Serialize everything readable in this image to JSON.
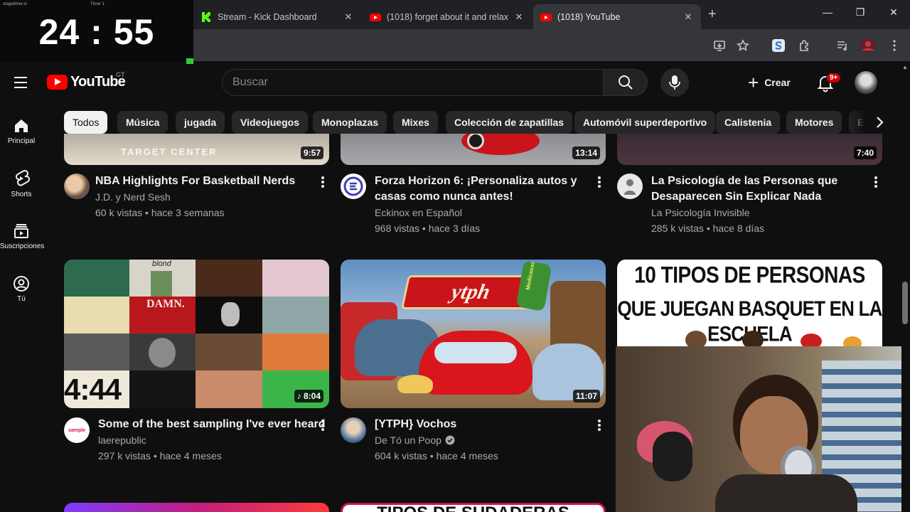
{
  "timer": {
    "app_name": "stagetimer.io",
    "timer_name": "Timer 1",
    "time": "24 : 55"
  },
  "browser": {
    "tabs": [
      {
        "title": "Stream - Kick Dashboard",
        "favicon_color": "#53fc18"
      },
      {
        "title": "(1018) forget about it and relax",
        "favicon_color": "#ff0000"
      },
      {
        "title": "(1018) YouTube",
        "favicon_color": "#ff0000"
      }
    ],
    "new_tab": "+",
    "window": {
      "minimize": "—",
      "maximize": "❐",
      "close": "✕"
    }
  },
  "header": {
    "logo": "YouTube",
    "country": "GT",
    "search_placeholder": "Buscar",
    "create_label": "Crear",
    "notifications_badge": "9+"
  },
  "chips": [
    "Todos",
    "Música",
    "jugada",
    "Videojuegos",
    "Monoplazas",
    "Mixes",
    "Colección de zapatillas",
    "Automóvil superdeportivo",
    "Calistenia",
    "Motores",
    "En"
  ],
  "sidebar": [
    {
      "label": "Principal",
      "icon": "home-icon"
    },
    {
      "label": "Shorts",
      "icon": "shorts-icon"
    },
    {
      "label": "Suscripciones",
      "icon": "subscriptions-icon"
    },
    {
      "label": "Tú",
      "icon": "you-icon"
    }
  ],
  "videos_row1": [
    {
      "title_lines": [
        "NBA Highlights For Basketball Nerds"
      ],
      "channel": "J.D. y Nerd Sesh",
      "stats": "60 k vistas • hace 3 semanas",
      "duration": "9:57",
      "thumb_text": "TARGET CENTER"
    },
    {
      "title_lines": [
        "Forza Horizon 6: ¡Personaliza autos y",
        "casas como nunca antes!"
      ],
      "channel": "Eckinox en Español",
      "stats": "968 vistas • hace 3 días",
      "duration": "13:14"
    },
    {
      "title_lines": [
        "La Psicología de las Personas que",
        "Desaparecen Sin Explicar Nada"
      ],
      "channel": "La Psicología Invisible",
      "stats": "285 k vistas • hace 8 días",
      "duration": "7:40"
    }
  ],
  "videos_row2": [
    {
      "title_lines": [
        "Some of the best sampling I've ever heard"
      ],
      "channel": "laerepublic",
      "stats": "297 k vistas • hace 4 meses",
      "duration": "8:04",
      "thumb_texts": [
        "blond",
        "DAMN.",
        "4:44"
      ],
      "channel_avatar_text": "sample"
    },
    {
      "title_lines": [
        "[YTPH} Vochos"
      ],
      "channel": "De Tó un Poop",
      "stats": "604 k vistas • hace 4 meses",
      "duration": "11:07",
      "thumb_text": "ytph",
      "thumb_can_text": "Medicasso"
    },
    {
      "title_lines": [],
      "thumb_lines": [
        "10 TIPOS DE PERSONAS",
        "QUE JUEGAN BASQUET EN LA ESCUELA"
      ]
    }
  ],
  "row3_thumb_text": "TIPOS DE SUDADERAS",
  "colors": {
    "bg": "#0f0f0f",
    "chip": "#272727",
    "brand_red": "#ff0000",
    "meta_text": "#aaaaaa"
  }
}
